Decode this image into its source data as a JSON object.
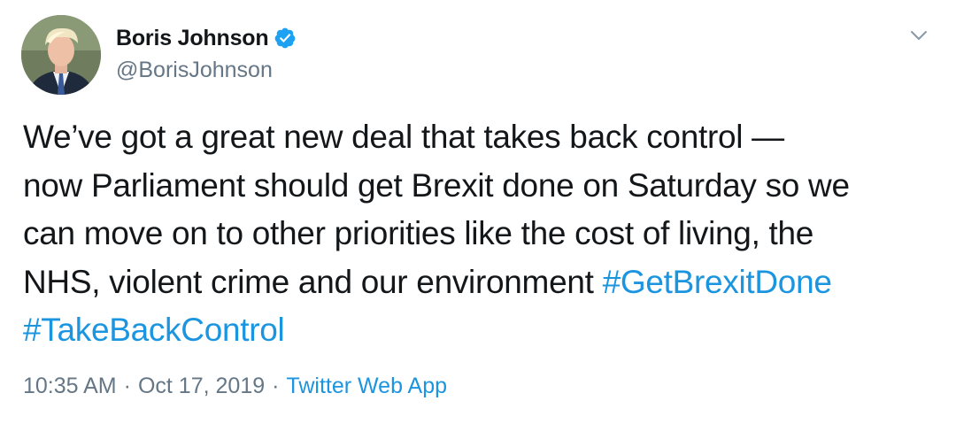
{
  "author": {
    "display_name": "Boris Johnson",
    "handle": "@BorisJohnson",
    "verified": true,
    "avatar_icon": "profile-photo"
  },
  "tweet": {
    "lines": [
      "We’ve got a great new deal that takes back control —",
      "now Parliament should get Brexit done on Saturday so we",
      "can move on to other priorities like the cost of living, the",
      "NHS, violent crime and our environment "
    ],
    "hashtags": [
      "#GetBrexitDone",
      "#TakeBackControl"
    ]
  },
  "meta": {
    "time": "10:35 AM",
    "separator": "·",
    "date": "Oct 17, 2019",
    "source": "Twitter Web App"
  },
  "icons": {
    "verified_badge": "verified-badge-icon",
    "menu": "chevron-down-icon"
  },
  "colors": {
    "text": "#14171a",
    "secondary": "#657786",
    "link": "#1b95e0",
    "verified": "#1da1f2"
  }
}
